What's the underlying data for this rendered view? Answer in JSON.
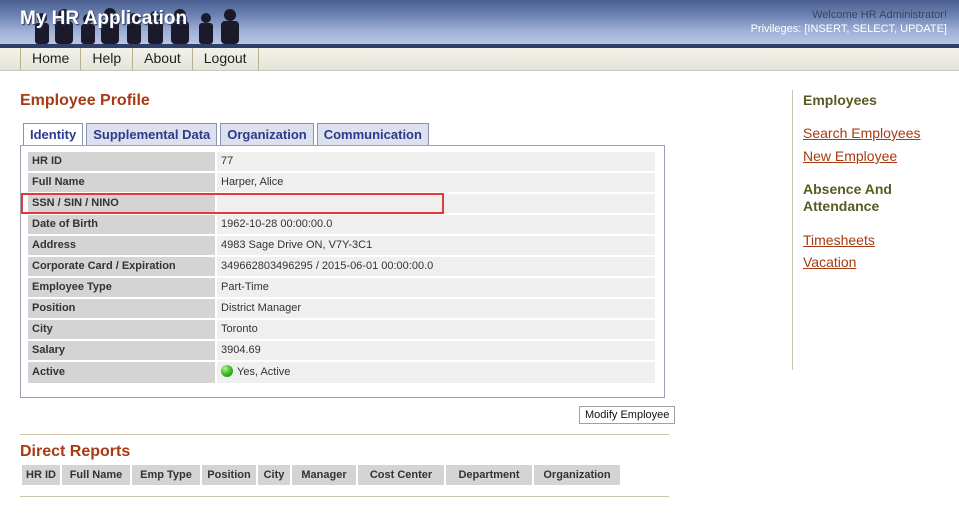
{
  "header": {
    "app_title": "My HR Application",
    "welcome": "Welcome HR Administrator!",
    "privileges": "Privileges: [INSERT, SELECT, UPDATE]"
  },
  "menu": {
    "items": [
      "Home",
      "Help",
      "About",
      "Logout"
    ]
  },
  "profile": {
    "title": "Employee Profile",
    "tabs": [
      "Identity",
      "Supplemental Data",
      "Organization",
      "Communication"
    ],
    "active_tab": "Identity",
    "fields": [
      {
        "label": "HR ID",
        "value": "77"
      },
      {
        "label": "Full Name",
        "value": "Harper, Alice"
      },
      {
        "label": "SSN / SIN / NINO",
        "value": ""
      },
      {
        "label": "Date of Birth",
        "value": "1962-10-28 00:00:00.0"
      },
      {
        "label": "Address",
        "value": "4983 Sage Drive ON, V7Y-3C1"
      },
      {
        "label": "Corporate Card / Expiration",
        "value": "349662803496295 / 2015-06-01 00:00:00.0"
      },
      {
        "label": "Employee Type",
        "value": "Part-Time"
      },
      {
        "label": "Position",
        "value": "District Manager"
      },
      {
        "label": "City",
        "value": "Toronto"
      },
      {
        "label": "Salary",
        "value": "3904.69"
      },
      {
        "label": "Active",
        "value": "Yes, Active"
      }
    ],
    "modify_button": "Modify Employee"
  },
  "direct_reports": {
    "title": "Direct Reports",
    "columns": [
      "HR ID",
      "Full Name",
      "Emp Type",
      "Position",
      "City",
      "Manager",
      "Cost Center",
      "Department",
      "Organization"
    ]
  },
  "sidebar": {
    "employees_heading": "Employees",
    "employees_links": [
      "Search Employees",
      "New Employee"
    ],
    "absence_heading": "Absence And Attendance",
    "absence_links": [
      "Timesheets",
      "Vacation"
    ]
  },
  "colors": {
    "accent": "#a83a12",
    "tab_text": "#2b3a8a",
    "sidebar_heading": "#5a5a22",
    "highlight": "#e03a3a",
    "active_indicator": "#42c12a"
  },
  "icons": {
    "active_status": "green-dot-icon"
  }
}
